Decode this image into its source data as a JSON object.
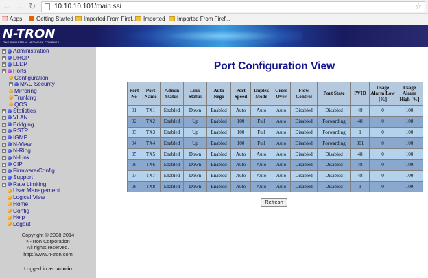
{
  "browser": {
    "url": "10.10.10.101/main.ssi",
    "bookmarks": [
      "Apps",
      "Getting Started",
      "Imported From Firef...",
      "Imported",
      "Imported From Firef..."
    ]
  },
  "banner": {
    "logo": "N-TRON",
    "tagline": "THE INDUSTRIAL NETWORK COMPANY"
  },
  "sidebar": {
    "items": [
      {
        "label": "Administration",
        "kind": "expand",
        "color": "blue",
        "indent": 0
      },
      {
        "label": "DHCP",
        "kind": "expand",
        "color": "blue",
        "indent": 0
      },
      {
        "label": "LLDP",
        "kind": "expand",
        "color": "blue",
        "indent": 0
      },
      {
        "label": "Ports",
        "kind": "expand",
        "color": "purple",
        "indent": 0
      },
      {
        "label": "Configuration",
        "kind": "leaf",
        "color": "orange",
        "indent": 1
      },
      {
        "label": "MAC Security",
        "kind": "expand",
        "color": "blue",
        "indent": 1
      },
      {
        "label": "Mirroring",
        "kind": "leaf",
        "color": "orange",
        "indent": 1
      },
      {
        "label": "Trunking",
        "kind": "leaf",
        "color": "orange",
        "indent": 1
      },
      {
        "label": "QOS",
        "kind": "leaf",
        "color": "orange",
        "indent": 1
      },
      {
        "label": "Statistics",
        "kind": "expand",
        "color": "blue",
        "indent": 0
      },
      {
        "label": "VLAN",
        "kind": "expand",
        "color": "blue",
        "indent": 0
      },
      {
        "label": "Bridging",
        "kind": "expand",
        "color": "blue",
        "indent": 0
      },
      {
        "label": "RSTP",
        "kind": "expand",
        "color": "blue",
        "indent": 0
      },
      {
        "label": "IGMP",
        "kind": "expand",
        "color": "blue",
        "indent": 0
      },
      {
        "label": "N-View",
        "kind": "expand",
        "color": "blue",
        "indent": 0
      },
      {
        "label": "N-Ring",
        "kind": "expand",
        "color": "blue",
        "indent": 0
      },
      {
        "label": "N-Link",
        "kind": "expand",
        "color": "blue",
        "indent": 0
      },
      {
        "label": "CIP",
        "kind": "expand",
        "color": "blue",
        "indent": 0
      },
      {
        "label": "Firmware/Config",
        "kind": "expand",
        "color": "blue",
        "indent": 0
      },
      {
        "label": "Support",
        "kind": "expand",
        "color": "blue",
        "indent": 0
      },
      {
        "label": "Rate Limiting",
        "kind": "expand",
        "color": "blue",
        "indent": 0
      },
      {
        "label": "User Management",
        "kind": "leaf",
        "color": "orange",
        "indent": 0
      },
      {
        "label": "Logical View",
        "kind": "leaf",
        "color": "orange",
        "indent": 0
      },
      {
        "label": "Home",
        "kind": "leaf",
        "color": "orange",
        "indent": 0
      },
      {
        "label": "Config",
        "kind": "leaf",
        "color": "orange",
        "indent": 0
      },
      {
        "label": "Help",
        "kind": "leaf",
        "color": "orange",
        "indent": 0
      },
      {
        "label": "Logout",
        "kind": "leaf",
        "color": "orange",
        "indent": 0
      }
    ],
    "copyright": "Copyright © 2008-2014",
    "company": "N-Tron Corporation",
    "rights": "All rights reserved.",
    "website": "http://www.n-tron.com",
    "logged_in_label": "Logged in as:",
    "logged_in_user": "admin"
  },
  "main": {
    "title": "Port Configuration View",
    "columns": [
      "Port No",
      "Port Name",
      "Admin Status",
      "Link Status",
      "Auto Nego",
      "Port Speed",
      "Duplex Mode",
      "Cross Over",
      "Flow Control",
      "Port State",
      "PVID",
      "Usage Alarm Low [%]",
      "Usage Alarm High [%]"
    ],
    "rows": [
      [
        "01",
        "TX1",
        "Enabled",
        "Down",
        "Enabled",
        "Auto",
        "Auto",
        "Auto",
        "Disabled",
        "Disabled",
        "48",
        "0",
        "100"
      ],
      [
        "02",
        "TX2",
        "Enabled",
        "Up",
        "Enabled",
        "100",
        "Full",
        "Auto",
        "Disabled",
        "Forwarding",
        "48",
        "0",
        "100"
      ],
      [
        "03",
        "TX3",
        "Enabled",
        "Up",
        "Enabled",
        "100",
        "Full",
        "Auto",
        "Disabled",
        "Forwarding",
        "1",
        "0",
        "100"
      ],
      [
        "04",
        "TX4",
        "Enabled",
        "Up",
        "Enabled",
        "100",
        "Full",
        "Auto",
        "Disabled",
        "Forwarding",
        "301",
        "0",
        "100"
      ],
      [
        "05",
        "TX5",
        "Enabled",
        "Down",
        "Enabled",
        "Auto",
        "Auto",
        "Auto",
        "Disabled",
        "Disabled",
        "48",
        "0",
        "100"
      ],
      [
        "06",
        "TX6",
        "Enabled",
        "Down",
        "Enabled",
        "Auto",
        "Auto",
        "Auto",
        "Disabled",
        "Disabled",
        "48",
        "0",
        "100"
      ],
      [
        "07",
        "TX7",
        "Enabled",
        "Down",
        "Enabled",
        "Auto",
        "Auto",
        "Auto",
        "Disabled",
        "Disabled",
        "48",
        "0",
        "100"
      ],
      [
        "08",
        "TX8",
        "Enabled",
        "Down",
        "Enabled",
        "Auto",
        "Auto",
        "Auto",
        "Disabled",
        "Disabled",
        "1",
        "0",
        "100"
      ]
    ],
    "refresh_label": "Refresh"
  },
  "colors": {
    "link_down": "#d01010",
    "row_dark": "#8aa8ce",
    "row_light": "#b4d2ec",
    "header_bg": "#b4c8de",
    "menu_text": "#14148c"
  }
}
